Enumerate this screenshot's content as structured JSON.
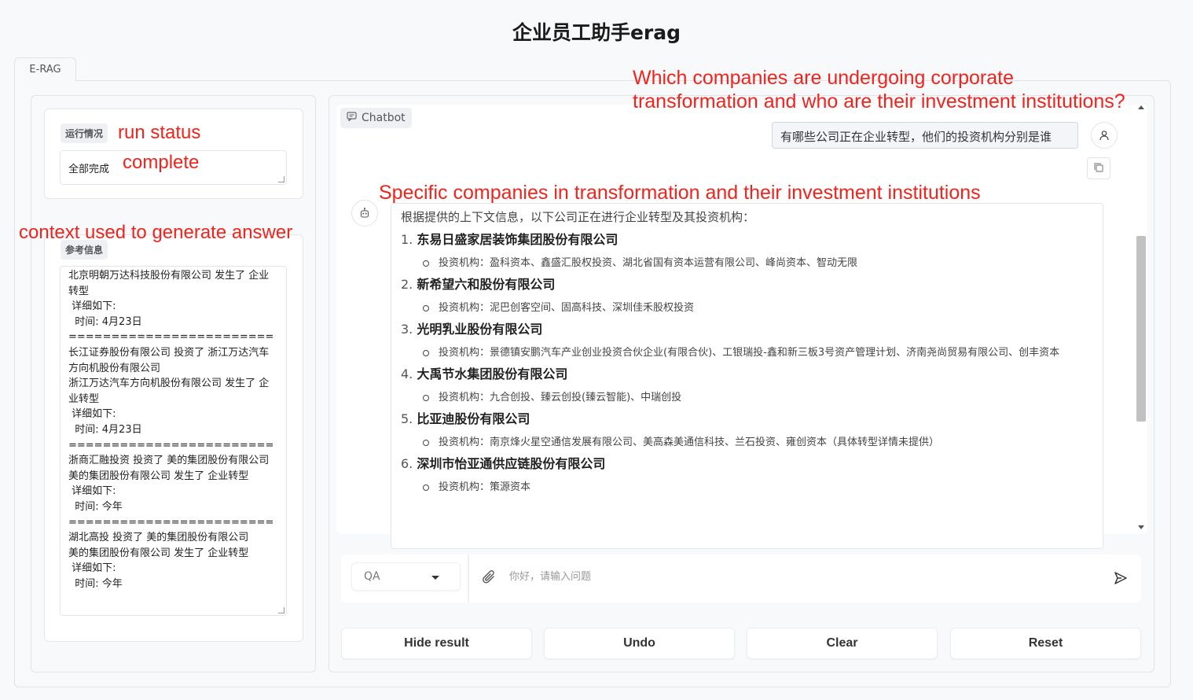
{
  "app": {
    "title": "企业员工助手erag"
  },
  "tabs": [
    {
      "label": "E-RAG"
    }
  ],
  "status": {
    "badge": "运行情况",
    "value": "全部完成"
  },
  "context": {
    "badge": "参考信息",
    "text": "北京明朝万达科技股份有限公司 发生了 企业转型\n 详细如下:\n  时间: 4月23日\n========================\n长江证券股份有限公司 投资了 浙江万达汽车方向机股份有限公司\n浙江万达汽车方向机股份有限公司 发生了 企业转型\n 详细如下:\n  时间: 4月23日\n========================\n浙商汇融投资 投资了 美的集团股份有限公司\n美的集团股份有限公司 发生了 企业转型\n 详细如下:\n  时间: 今年\n========================\n湖北高投 投资了 美的集团股份有限公司\n美的集团股份有限公司 发生了 企业转型\n 详细如下:\n  时间: 今年"
  },
  "annotations": {
    "question_en_line1": "Which companies are undergoing corporate",
    "question_en_line2": "transformation and who are their investment institutions?",
    "run_status": "run status",
    "complete": "complete",
    "context_used": "context used to generate answer",
    "answer_en": "Specific companies in transformation and their investment institutions"
  },
  "chatbot": {
    "label": "Chatbot",
    "user_message": "有哪些公司正在企业转型，他们的投资机构分别是谁",
    "bot_intro": "根据提供的上下文信息，以下公司正在进行企业转型及其投资机构：",
    "companies": [
      {
        "num": "1.",
        "name": "东易日盛家居装饰集团股份有限公司",
        "investors": "投资机构：盈科资本、鑫盛汇股权投资、湖北省国有资本运营有限公司、峰尚资本、智动无限"
      },
      {
        "num": "2.",
        "name": "新希望六和股份有限公司",
        "investors": "投资机构：泥巴创客空间、固高科技、深圳佳禾股权投资"
      },
      {
        "num": "3.",
        "name": "光明乳业股份有限公司",
        "investors": "投资机构：景德镇安鹏汽车产业创业投资合伙企业(有限合伙)、工银瑞投-鑫和新三板3号资产管理计划、济南尧尚贸易有限公司、创丰资本"
      },
      {
        "num": "4.",
        "name": "大禹节水集团股份有限公司",
        "investors": "投资机构：九合创投、臻云创投(臻云智能)、中瑞创投"
      },
      {
        "num": "5.",
        "name": "比亚迪股份有限公司",
        "investors": "投资机构：南京烽火星空通信发展有限公司、美高森美通信科技、兰石投资、雍创资本（具体转型详情未提供）"
      },
      {
        "num": "6.",
        "name": "深圳市怡亚通供应链股份有限公司",
        "investors": "投资机构：策源资本"
      }
    ]
  },
  "input": {
    "mode": "QA",
    "placeholder": "你好，请输入问题"
  },
  "buttons": {
    "hide_result": "Hide result",
    "undo": "Undo",
    "clear": "Clear",
    "reset": "Reset"
  },
  "icons": {
    "chatbot": "chat-bubble-icon",
    "user_avatar": "user-icon",
    "bot_avatar": "robot-icon",
    "copy": "copy-icon",
    "attach": "paperclip-icon",
    "send": "send-icon"
  }
}
